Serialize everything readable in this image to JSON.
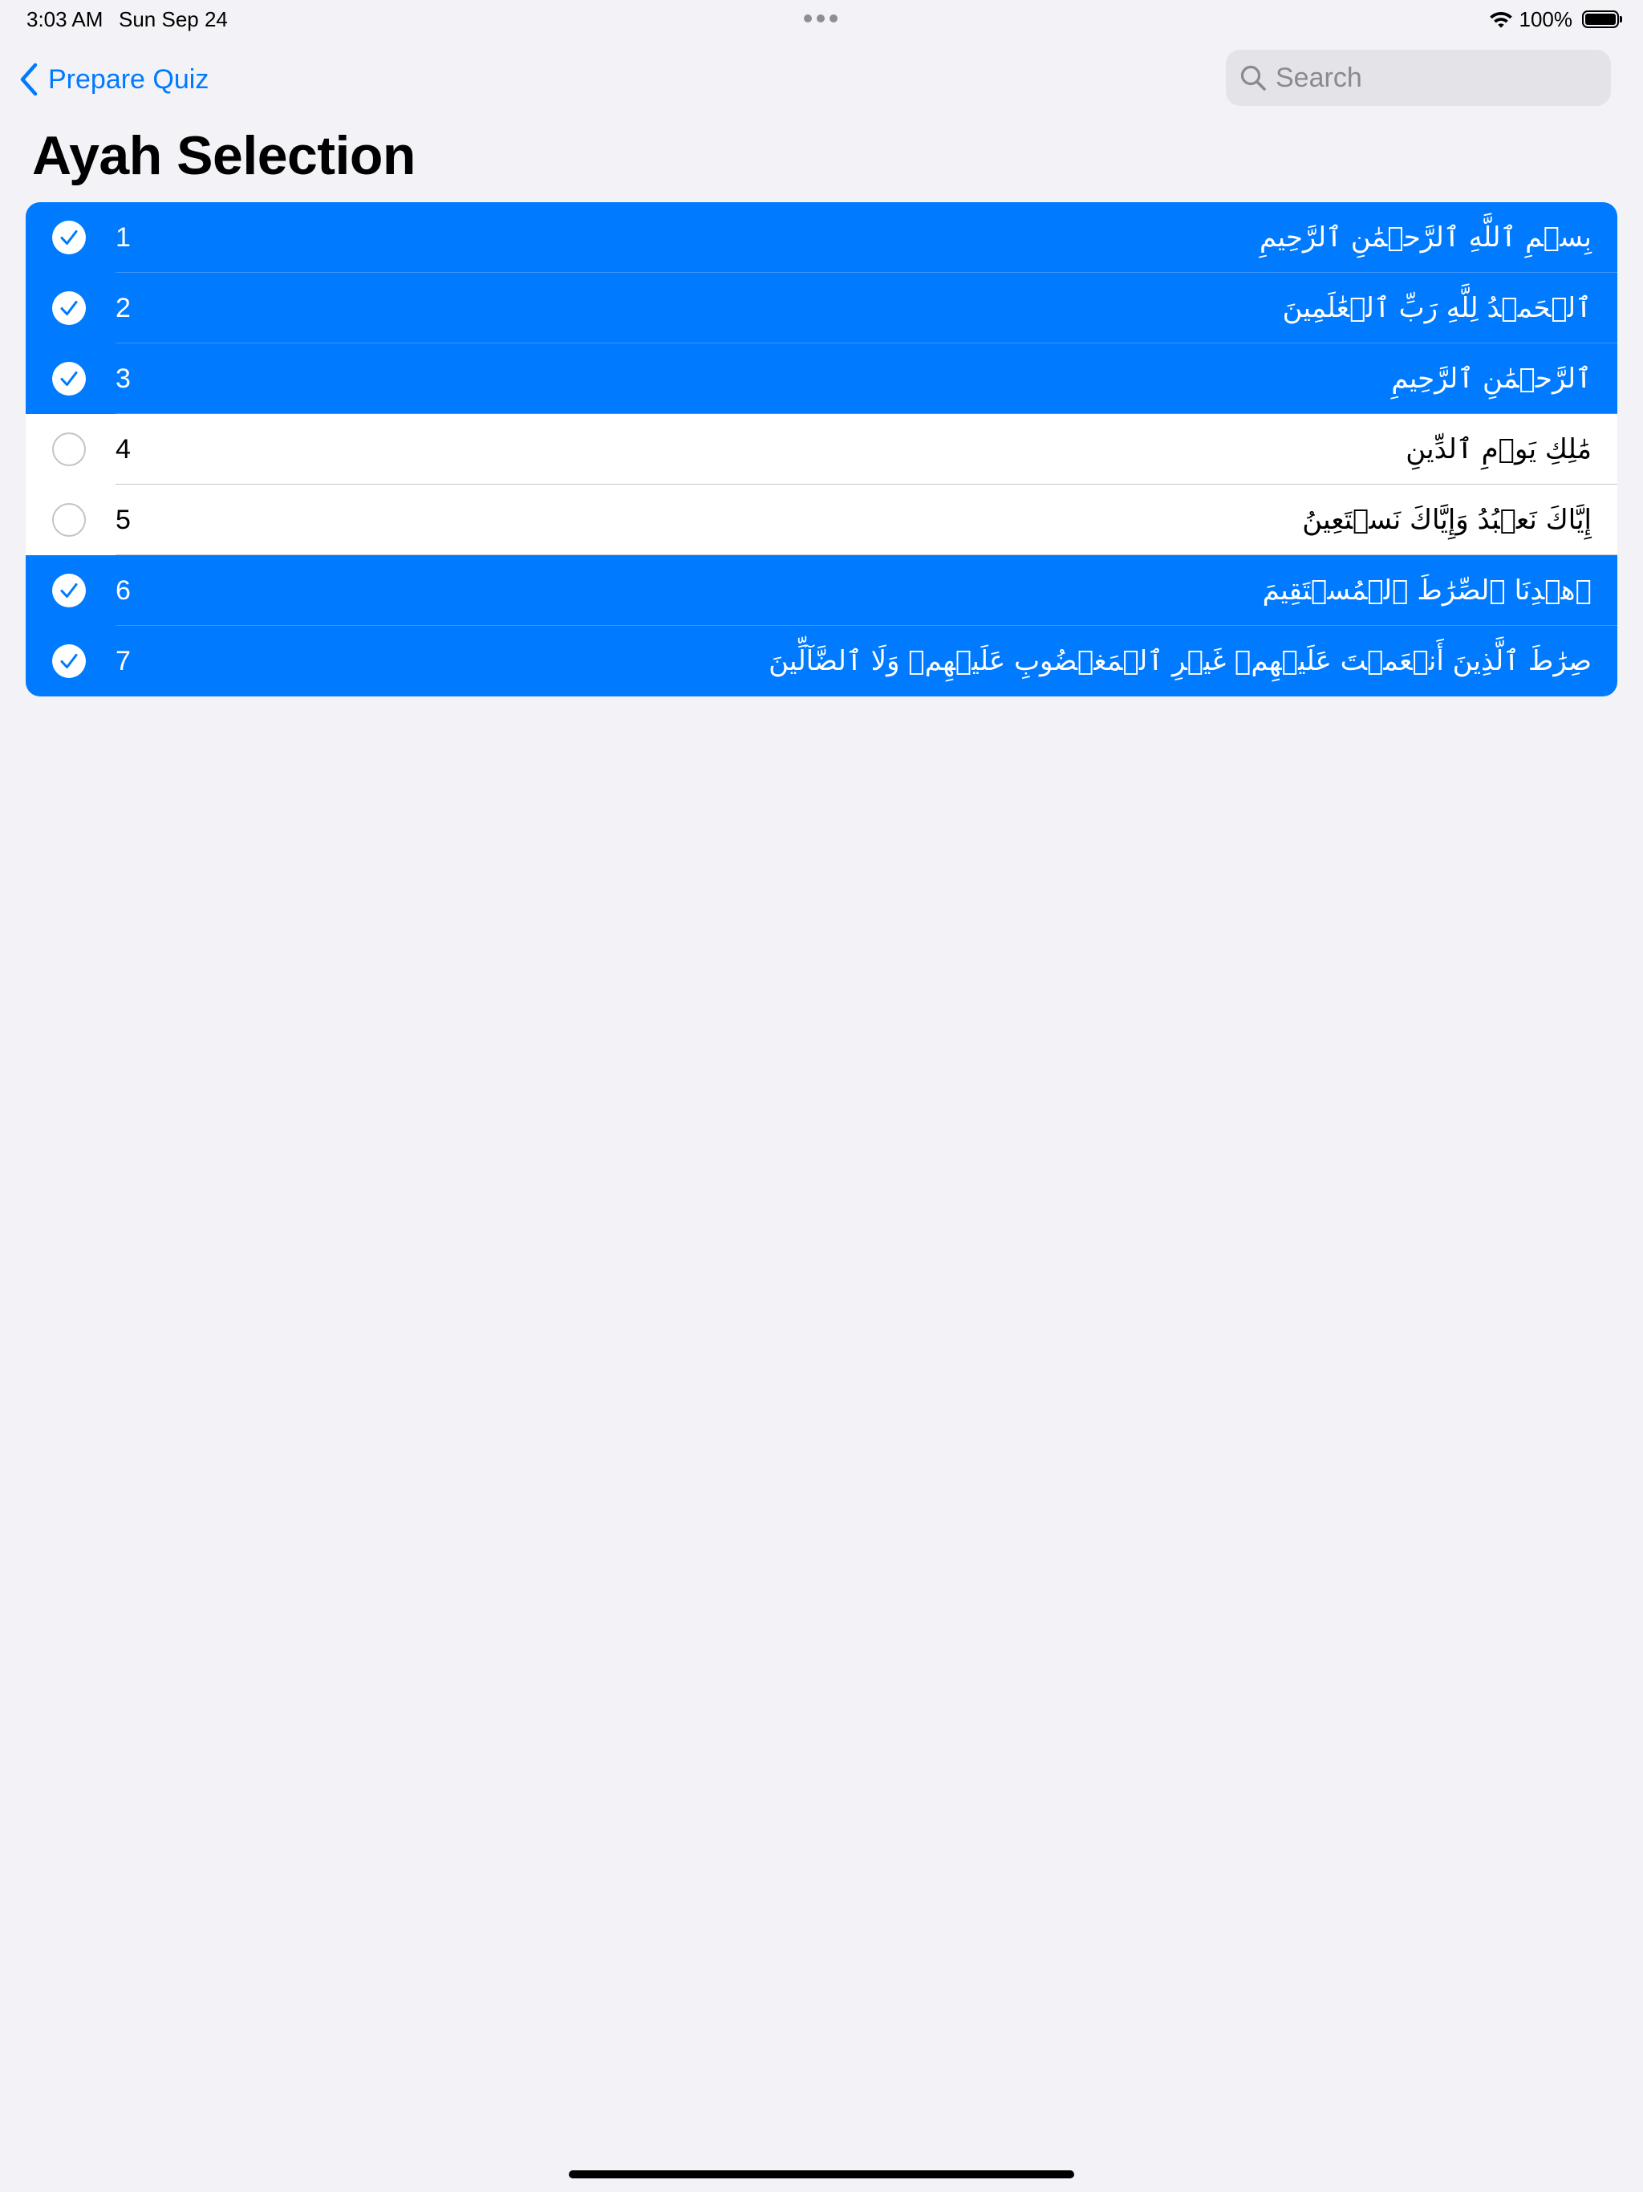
{
  "status_bar": {
    "time": "3:03 AM",
    "date": "Sun Sep 24",
    "battery": "100%",
    "icons": [
      "wifi-icon",
      "battery-icon",
      "multitask-dots-icon"
    ]
  },
  "nav": {
    "back_label": "Prepare Quiz",
    "back_icon": "chevron-left-icon",
    "search_placeholder": "Search",
    "search_value": "",
    "search_icon": "magnifying-glass-icon"
  },
  "page": {
    "title": "Ayah Selection"
  },
  "colors": {
    "accent": "#007aff",
    "background": "#f2f2f7",
    "row_unselected": "#ffffff",
    "unchecked_circle": "#c4c4c6"
  },
  "ayahs": [
    {
      "number": "1",
      "text": "بِسۡمِ ٱللَّهِ ٱلرَّحۡمَٰنِ ٱلرَّحِيمِ",
      "selected": true
    },
    {
      "number": "2",
      "text": "ٱلۡحَمۡدُ لِلَّهِ رَبِّ ٱلۡعَٰلَمِينَ",
      "selected": true
    },
    {
      "number": "3",
      "text": "ٱلرَّحۡمَٰنِ ٱلرَّحِيمِ",
      "selected": true
    },
    {
      "number": "4",
      "text": "مَٰلِكِ يَوۡمِ ٱلدِّينِ",
      "selected": false
    },
    {
      "number": "5",
      "text": "إِيَّاكَ نَعۡبُدُ وَإِيَّاكَ نَسۡتَعِينُ",
      "selected": false
    },
    {
      "number": "6",
      "text": "ٱهۡدِنَا ٱلصِّرَٰطَ ٱلۡمُسۡتَقِيمَ",
      "selected": true
    },
    {
      "number": "7",
      "text": "صِرَٰطَ ٱلَّذِينَ أَنۡعَمۡتَ عَلَيۡهِمۡ غَيۡرِ ٱلۡمَغۡضُوبِ عَلَيۡهِمۡ وَلَا ٱلضَّآلِّينَ",
      "selected": true
    }
  ]
}
